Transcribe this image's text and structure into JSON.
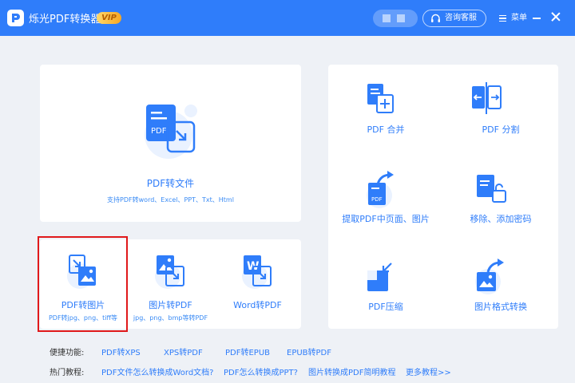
{
  "titlebar": {
    "app_title": "烁光PDF转换器",
    "vip_badge": "VIP",
    "consult_label": "咨询客服",
    "menu_label": "菜单"
  },
  "colors": {
    "brand_blue": "#2f7dfa",
    "highlight_red": "#e0191b"
  },
  "main_card": {
    "title": "PDF转文件",
    "subtitle": "支持PDF转word、Excel、PPT、Txt、Html",
    "icon": "pdf-convert-icon"
  },
  "convert_row": [
    {
      "title": "PDF转图片",
      "subtitle": "PDF转jpg、png、tiff等",
      "icon": "pdf-to-image-icon"
    },
    {
      "title": "图片转PDF",
      "subtitle": "jpg、png、bmp等转PDF",
      "icon": "image-to-pdf-icon"
    },
    {
      "title": "Word转PDF",
      "subtitle": "",
      "icon": "word-to-pdf-icon"
    }
  ],
  "tools": [
    {
      "title": "PDF 合并",
      "icon": "pdf-merge-icon"
    },
    {
      "title": "PDF 分割",
      "icon": "pdf-split-icon"
    },
    {
      "title": "提取PDF中页面、图片",
      "icon": "extract-pages-icon"
    },
    {
      "title": "移除、添加密码",
      "icon": "password-lock-icon"
    },
    {
      "title": "PDF压缩",
      "icon": "pdf-compress-icon"
    },
    {
      "title": "图片格式转换",
      "icon": "image-format-icon"
    }
  ],
  "quick": {
    "label": "便捷功能:",
    "links": [
      "PDF转XPS",
      "XPS转PDF",
      "PDF转EPUB",
      "EPUB转PDF"
    ]
  },
  "tutorials": {
    "label": "热门教程:",
    "links": [
      "PDF文件怎么转换成Word文档?",
      "PDF怎么转换成PPT?",
      "图片转换成PDF简明教程",
      "更多教程>>"
    ]
  }
}
